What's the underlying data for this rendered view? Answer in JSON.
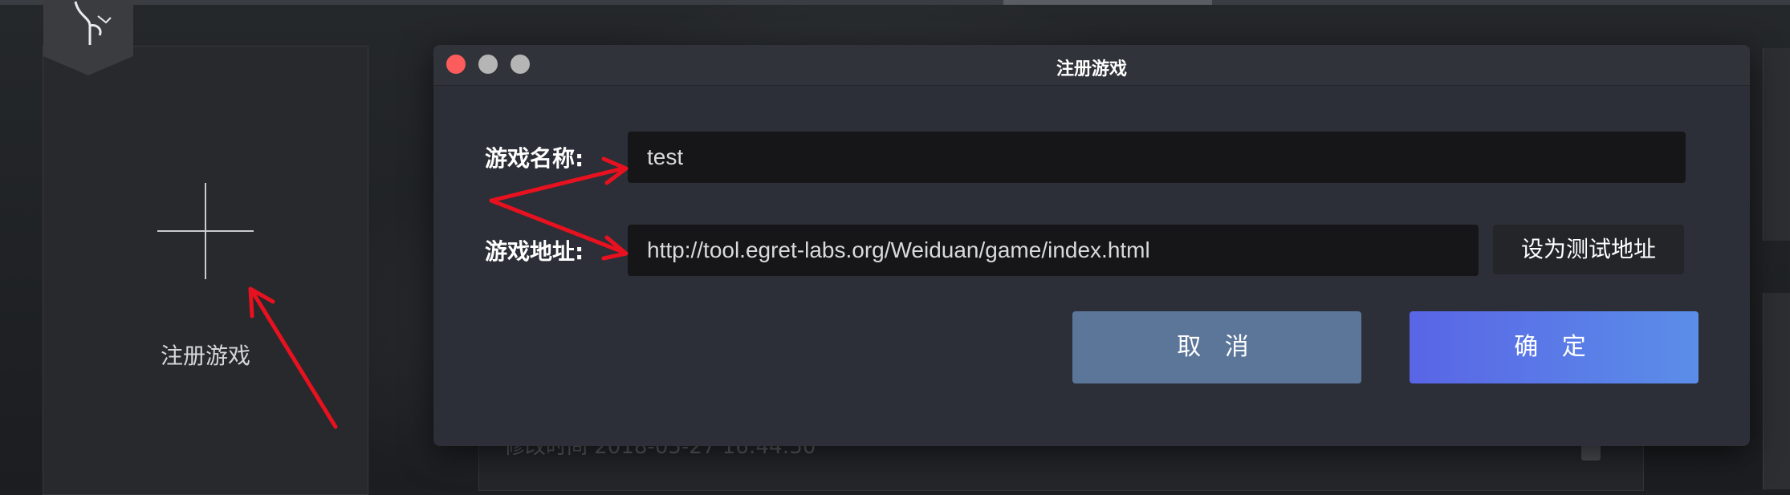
{
  "sidebar_card": {
    "label": "注册游戏",
    "icon": "plus-icon"
  },
  "dialog": {
    "title": "注册游戏",
    "traffic_lights": [
      "close",
      "minimize",
      "maximize"
    ],
    "name_label": "游戏名称:",
    "name_value": "test",
    "url_label": "游戏地址:",
    "url_value": "http://tool.egret-labs.org/Weiduan/game/index.html",
    "set_test_url_button": "设为测试地址",
    "cancel_button": "取 消",
    "ok_button": "确 定"
  },
  "colors": {
    "annotation_arrow": "#e8111f",
    "ok_button_start": "#5965e6",
    "ok_button_end": "#5b8ee8",
    "cancel_button": "#5b7699",
    "close_light": "#fc5c5c"
  }
}
